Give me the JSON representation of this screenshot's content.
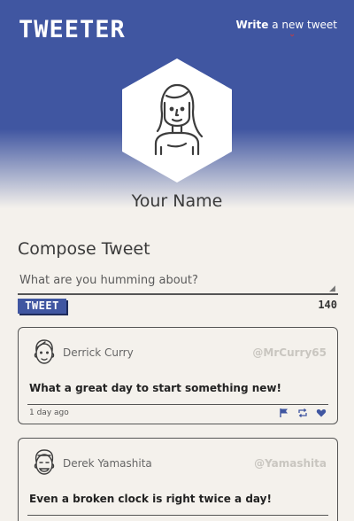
{
  "header": {
    "brand": "TWEETER",
    "write_strong": "Write",
    "write_rest": " a new tweet",
    "write_arrow": "⌄"
  },
  "profile": {
    "name": "Your Name",
    "avatar_icon": "woman-avatar-icon"
  },
  "compose": {
    "title": "Compose Tweet",
    "placeholder": "What are you humming about?",
    "button_label": "TWEET",
    "counter": "140"
  },
  "tweets": [
    {
      "name": "Derrick Curry",
      "handle": "@MrCurry65",
      "text": "What a great day to start something new!",
      "time": "1 day ago",
      "avatar_icon": "man-avatar-icon"
    },
    {
      "name": "Derek Yamashita",
      "handle": "@Yamashita",
      "text": "Even a broken clock is right twice a day!",
      "time": "",
      "avatar_icon": "man-avatar-icon"
    }
  ],
  "colors": {
    "brand_blue": "#4056a1",
    "accent_red": "#d23a3a",
    "background": "#f4f1ec"
  }
}
